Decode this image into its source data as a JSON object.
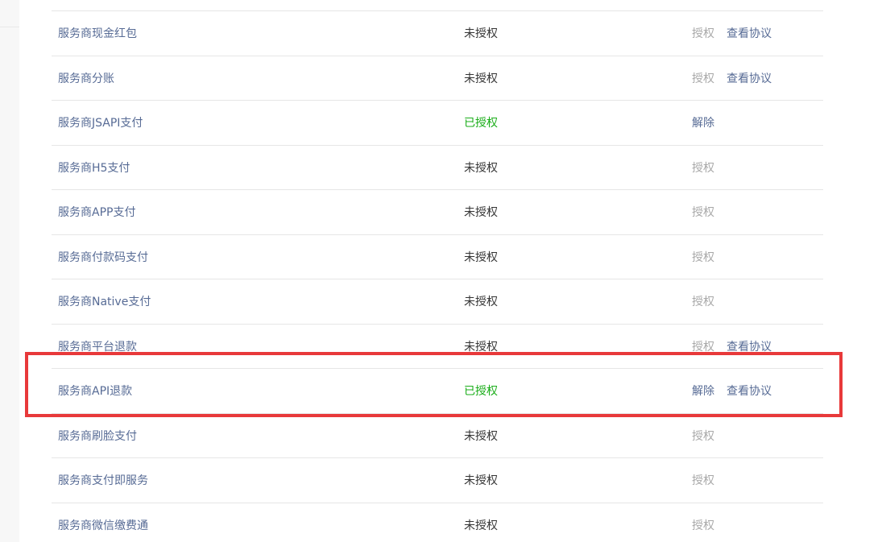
{
  "rows": [
    {
      "name": "服务商现金红包",
      "status": "未授权",
      "authorized": false,
      "actions": [
        {
          "label": "授权",
          "kind": "disabled"
        },
        {
          "label": "查看协议",
          "kind": "link"
        }
      ]
    },
    {
      "name": "服务商分账",
      "status": "未授权",
      "authorized": false,
      "actions": [
        {
          "label": "授权",
          "kind": "disabled"
        },
        {
          "label": "查看协议",
          "kind": "link"
        }
      ]
    },
    {
      "name": "服务商JSAPI支付",
      "status": "已授权",
      "authorized": true,
      "actions": [
        {
          "label": "解除",
          "kind": "link"
        }
      ]
    },
    {
      "name": "服务商H5支付",
      "status": "未授权",
      "authorized": false,
      "actions": [
        {
          "label": "授权",
          "kind": "disabled"
        }
      ]
    },
    {
      "name": "服务商APP支付",
      "status": "未授权",
      "authorized": false,
      "actions": [
        {
          "label": "授权",
          "kind": "disabled"
        }
      ]
    },
    {
      "name": "服务商付款码支付",
      "status": "未授权",
      "authorized": false,
      "actions": [
        {
          "label": "授权",
          "kind": "disabled"
        }
      ]
    },
    {
      "name": "服务商Native支付",
      "status": "未授权",
      "authorized": false,
      "actions": [
        {
          "label": "授权",
          "kind": "disabled"
        }
      ]
    },
    {
      "name": "服务商平台退款",
      "status": "未授权",
      "authorized": false,
      "actions": [
        {
          "label": "授权",
          "kind": "disabled"
        },
        {
          "label": "查看协议",
          "kind": "link"
        }
      ]
    },
    {
      "name": "服务商API退款",
      "status": "已授权",
      "authorized": true,
      "highlighted": true,
      "actions": [
        {
          "label": "解除",
          "kind": "link"
        },
        {
          "label": "查看协议",
          "kind": "link"
        }
      ]
    },
    {
      "name": "服务商刷脸支付",
      "status": "未授权",
      "authorized": false,
      "actions": [
        {
          "label": "授权",
          "kind": "disabled"
        }
      ]
    },
    {
      "name": "服务商支付即服务",
      "status": "未授权",
      "authorized": false,
      "actions": [
        {
          "label": "授权",
          "kind": "disabled"
        }
      ]
    },
    {
      "name": "服务商微信缴费通",
      "status": "未授权",
      "authorized": false,
      "actions": [
        {
          "label": "授权",
          "kind": "disabled"
        }
      ]
    }
  ],
  "colors": {
    "link": "#576b95",
    "authorized": "#1aad19",
    "unauthorized": "#353535",
    "disabled": "#a8a8a8",
    "highlight": "#e8393a"
  }
}
